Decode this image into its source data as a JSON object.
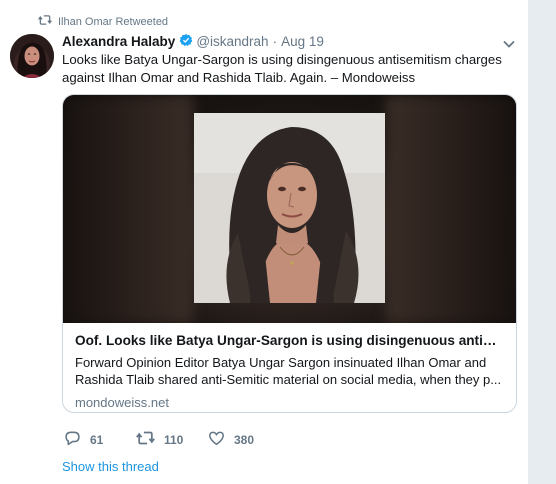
{
  "retweet_context": {
    "text": "Ilhan Omar Retweeted",
    "icon": "retweet-icon"
  },
  "author": {
    "name": "Alexandra Halaby",
    "verified": true,
    "handle": "@iskandrah",
    "separator": "·",
    "date": "Aug 19"
  },
  "tweet": {
    "text": "Looks like Batya Ungar-Sargon is using disingenuous antisemitism charges against Ilhan Omar and Rashida Tlaib. Again. – Mondoweiss"
  },
  "card": {
    "title": "Oof. Looks like Batya Ungar-Sargon is using disingenuous antisemiti...",
    "description": "Forward Opinion Editor Batya Ungar Sargon insinuated Ilhan Omar and Rashida Tlaib shared anti-Semitic material on social media, when they p...",
    "domain": "mondoweiss.net"
  },
  "actions": {
    "reply_count": "61",
    "retweet_count": "110",
    "like_count": "380"
  },
  "show_thread": "Show this thread",
  "colors": {
    "link": "#1b95e0",
    "muted": "#657786",
    "border": "#ccd6dd",
    "verified": "#1da1f2"
  }
}
